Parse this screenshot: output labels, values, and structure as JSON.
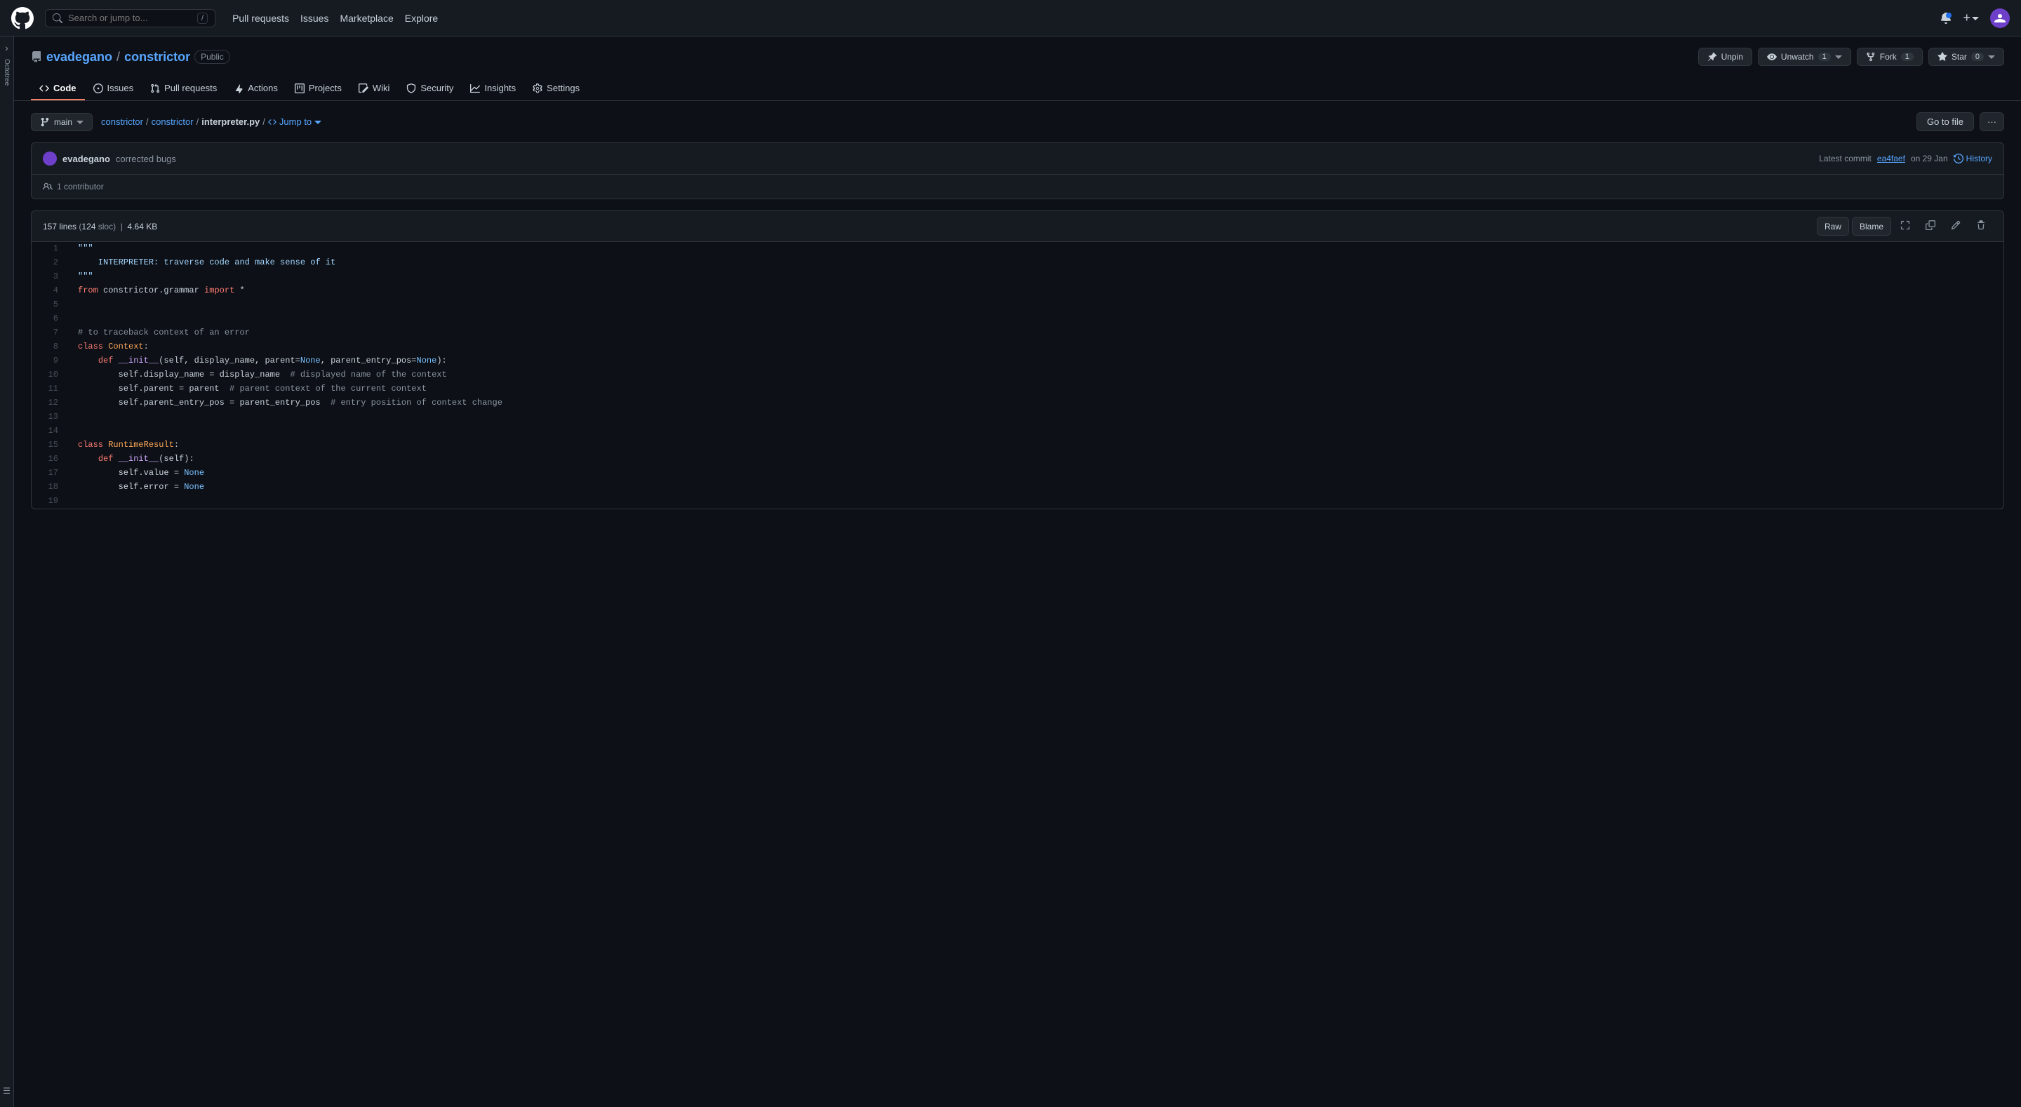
{
  "topnav": {
    "search_placeholder": "Search or jump to...",
    "shortcut": "/",
    "links": [
      {
        "label": "Pull requests",
        "href": "#"
      },
      {
        "label": "Issues",
        "href": "#"
      },
      {
        "label": "Marketplace",
        "href": "#"
      },
      {
        "label": "Explore",
        "href": "#"
      }
    ]
  },
  "repo": {
    "owner": "evadegano",
    "name": "constrictor",
    "visibility": "Public",
    "buttons": {
      "unpin": "Unpin",
      "unwatch": "Unwatch",
      "unwatch_count": "1",
      "fork": "Fork",
      "fork_count": "1",
      "star": "Star",
      "star_count": "0"
    }
  },
  "tabs": [
    {
      "id": "code",
      "label": "Code",
      "icon": "<>",
      "active": true
    },
    {
      "id": "issues",
      "label": "Issues",
      "icon": "⊙"
    },
    {
      "id": "pull-requests",
      "label": "Pull requests",
      "icon": "⑃"
    },
    {
      "id": "actions",
      "label": "Actions",
      "icon": "▶"
    },
    {
      "id": "projects",
      "label": "Projects",
      "icon": "⊞"
    },
    {
      "id": "wiki",
      "label": "Wiki",
      "icon": "📖"
    },
    {
      "id": "security",
      "label": "Security",
      "icon": "🛡"
    },
    {
      "id": "insights",
      "label": "Insights",
      "icon": "📈"
    },
    {
      "id": "settings",
      "label": "Settings",
      "icon": "⚙"
    }
  ],
  "breadcrumb": {
    "branch": "main",
    "paths": [
      {
        "label": "constrictor",
        "href": "#"
      },
      {
        "label": "constrictor",
        "href": "#"
      },
      {
        "label": "interpreter.py",
        "current": true
      }
    ],
    "jump_to": "Jump to"
  },
  "commit": {
    "author": "evadegano",
    "message": "corrected bugs",
    "prefix": "Latest commit",
    "hash": "ea4faef",
    "date": "on 29 Jan",
    "history_label": "History",
    "contributors": "1 contributor"
  },
  "file": {
    "lines": "157",
    "sloc": "124",
    "size": "4.64 KB",
    "toolbar": {
      "raw": "Raw",
      "blame": "Blame"
    }
  },
  "code_lines": [
    {
      "num": 1,
      "content": "\"\"\""
    },
    {
      "num": 2,
      "content": "    INTERPRETER: traverse code and make sense of it"
    },
    {
      "num": 3,
      "content": "\"\"\""
    },
    {
      "num": 4,
      "content": "from constrictor.grammar import *"
    },
    {
      "num": 5,
      "content": ""
    },
    {
      "num": 6,
      "content": ""
    },
    {
      "num": 7,
      "content": "# to traceback context of an error"
    },
    {
      "num": 8,
      "content": "class Context:"
    },
    {
      "num": 9,
      "content": "    def __init__(self, display_name, parent=None, parent_entry_pos=None):"
    },
    {
      "num": 10,
      "content": "        self.display_name = display_name  # displayed name of the context"
    },
    {
      "num": 11,
      "content": "        self.parent = parent  # parent context of the current context"
    },
    {
      "num": 12,
      "content": "        self.parent_entry_pos = parent_entry_pos  # entry position of context change"
    },
    {
      "num": 13,
      "content": ""
    },
    {
      "num": 14,
      "content": ""
    },
    {
      "num": 15,
      "content": "class RuntimeResult:"
    },
    {
      "num": 16,
      "content": "    def __init__(self):"
    },
    {
      "num": 17,
      "content": "        self.value = None"
    },
    {
      "num": 18,
      "content": "        self.error = None"
    },
    {
      "num": 19,
      "content": ""
    }
  ]
}
